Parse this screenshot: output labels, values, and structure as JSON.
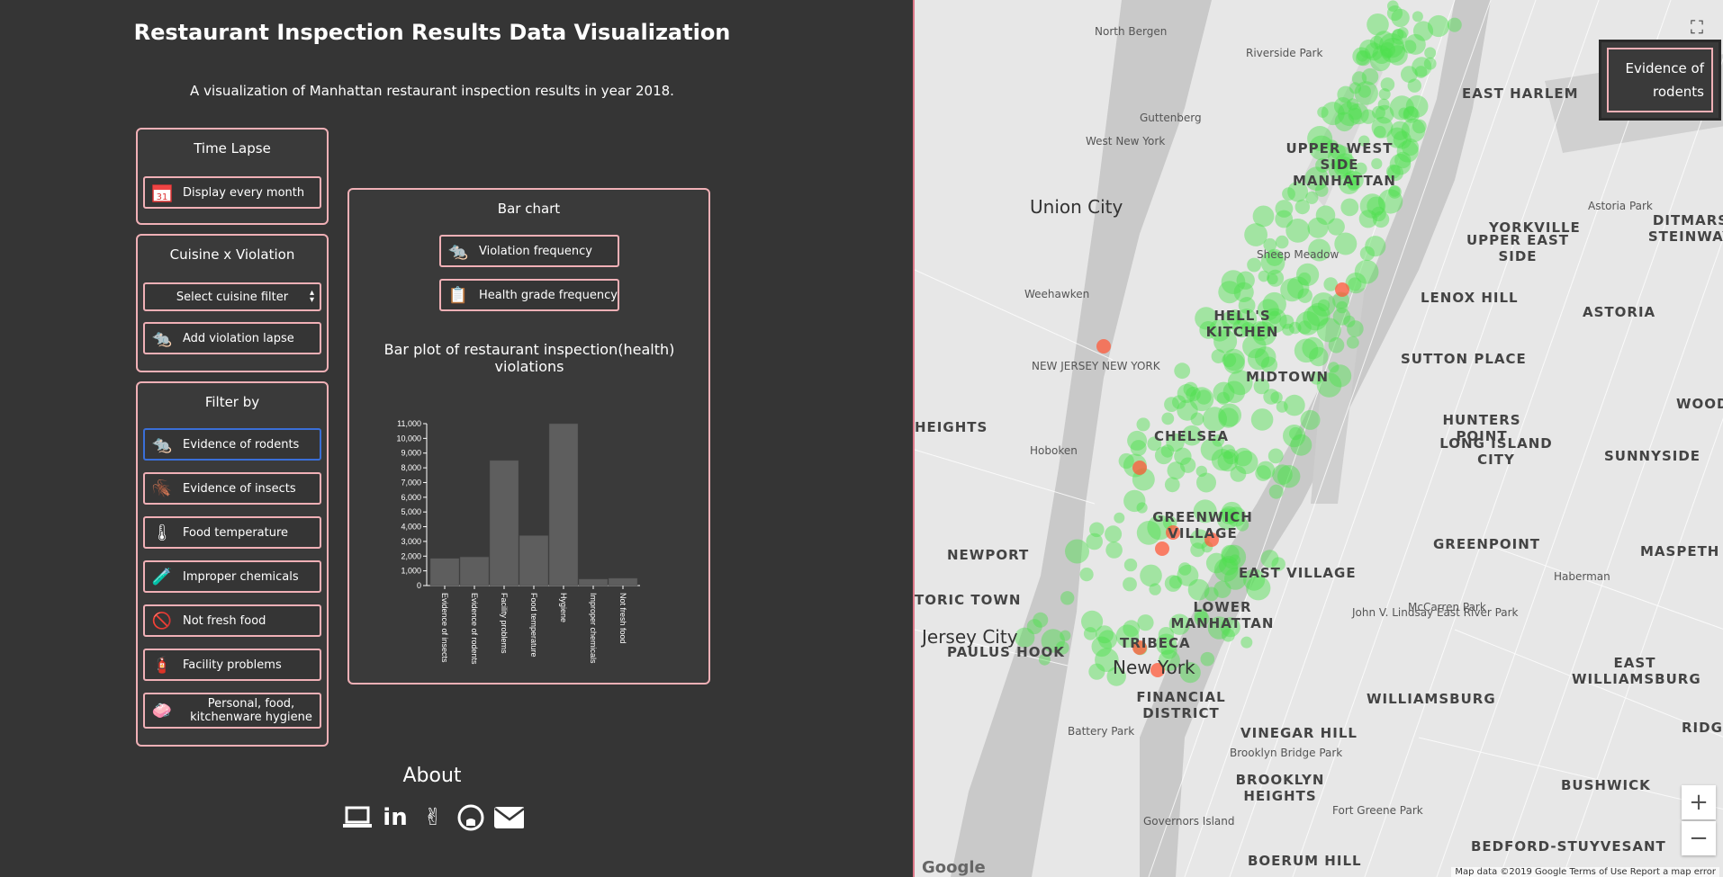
{
  "header": {
    "title": "Restaurant Inspection Results Data Visualization",
    "subtitle": "A visualization of Manhattan restaurant inspection results in year 2018."
  },
  "time_lapse": {
    "title": "Time Lapse",
    "button": {
      "label": "Display every month",
      "icon": "calendar-icon"
    }
  },
  "cuisine": {
    "title": "Cuisine x Violation",
    "select_value": "Select cuisine filter",
    "button": {
      "label": "Add violation lapse",
      "icon": "rat-icon"
    }
  },
  "filter": {
    "title": "Filter by",
    "items": [
      {
        "label": "Evidence of rodents",
        "icon": "rat-icon",
        "glyph": "🐀",
        "active": true
      },
      {
        "label": "Evidence of insects",
        "icon": "insect-icon",
        "glyph": "🪳",
        "active": false
      },
      {
        "label": "Food temperature",
        "icon": "thermometer-icon",
        "glyph": "🌡",
        "active": false
      },
      {
        "label": "Improper chemicals",
        "icon": "chemical-bottle-icon",
        "glyph": "🧪",
        "active": false
      },
      {
        "label": "Not fresh food",
        "icon": "no-food-icon",
        "glyph": "🚫",
        "active": false
      },
      {
        "label": "Facility problems",
        "icon": "facility-icon",
        "glyph": "🧯",
        "active": false
      },
      {
        "label": "Personal, food, kitchenware hygiene",
        "icon": "handwash-icon",
        "glyph": "🧼",
        "active": false
      }
    ]
  },
  "bar_panel": {
    "title": "Bar chart",
    "buttons": [
      {
        "label": "Violation frequency",
        "icon": "rat-icon",
        "glyph": "🐀"
      },
      {
        "label": "Health grade frequency",
        "icon": "grade-report-icon",
        "glyph": "📋"
      }
    ]
  },
  "chart_data": {
    "type": "bar",
    "title": "Bar plot of restaurant inspection(health) violations",
    "categories": [
      "Evidence of insects",
      "Evidence of rodents",
      "Facility problems",
      "Food temperature",
      "Hygiene",
      "Improper chemicals",
      "Not fresh food"
    ],
    "values": [
      1850,
      1950,
      8500,
      3400,
      11000,
      450,
      500
    ],
    "ylim": [
      0,
      11000
    ],
    "yticks": [
      "0",
      "1,000",
      "2,000",
      "3,000",
      "4,000",
      "5,000",
      "6,000",
      "7,000",
      "8,000",
      "9,000",
      "10,000",
      "11,000"
    ],
    "color": "#5e5e5e",
    "xlabel": "",
    "ylabel": ""
  },
  "about": {
    "title": "About",
    "icons": [
      {
        "name": "laptop-icon",
        "glyph": "💻"
      },
      {
        "name": "linkedin-icon",
        "glyph": "in"
      },
      {
        "name": "angellist-icon",
        "glyph": "✌"
      },
      {
        "name": "github-icon",
        "glyph": "◉"
      },
      {
        "name": "email-icon",
        "glyph": "✉"
      }
    ]
  },
  "map": {
    "legend": "Evidence of rodents",
    "zoom_in": "+",
    "zoom_out": "−",
    "fullscreen": "⛶",
    "google": "Google",
    "attribution": "Map data ©2019 Google   Terms of Use   Report a map error",
    "labels": [
      {
        "text": "North Bergen"
      },
      {
        "text": "Riverside Park"
      },
      {
        "text": "EAST HARLEM"
      },
      {
        "text": "Guttenberg"
      },
      {
        "text": "West New York"
      },
      {
        "text": "UPPER WEST SIDE"
      },
      {
        "text": "MANHATTAN"
      },
      {
        "text": "Union City"
      },
      {
        "text": "YORKVILLE"
      },
      {
        "text": "DITMARS STEINWAY"
      },
      {
        "text": "Sheep Meadow"
      },
      {
        "text": "UPPER EAST SIDE"
      },
      {
        "text": "Astoria Park"
      },
      {
        "text": "Weehawken"
      },
      {
        "text": "LENOX HILL"
      },
      {
        "text": "ASTORIA"
      },
      {
        "text": "HELL'S KITCHEN"
      },
      {
        "text": "SUTTON PLACE"
      },
      {
        "text": "MIDTOWN"
      },
      {
        "text": "HEIGHTS"
      },
      {
        "text": "HUNTERS POINT"
      },
      {
        "text": "WOODSIDE"
      },
      {
        "text": "Hoboken"
      },
      {
        "text": "CHELSEA"
      },
      {
        "text": "LONG ISLAND CITY"
      },
      {
        "text": "SUNNYSIDE"
      },
      {
        "text": "GREENWICH VILLAGE"
      },
      {
        "text": "GREENPOINT"
      },
      {
        "text": "MASPETH"
      },
      {
        "text": "NEWPORT"
      },
      {
        "text": "EAST VILLAGE"
      },
      {
        "text": "Haberman"
      },
      {
        "text": "TORIC TOWN"
      },
      {
        "text": "LOWER MANHATTAN"
      },
      {
        "text": "John V. Lindsay East River Park"
      },
      {
        "text": "McCarren Park"
      },
      {
        "text": "Jersey City"
      },
      {
        "text": "PAULUS HOOK"
      },
      {
        "text": "TRIBECA"
      },
      {
        "text": "EAST WILLIAMSBURG"
      },
      {
        "text": "New York"
      },
      {
        "text": "FINANCIAL DISTRICT"
      },
      {
        "text": "WILLIAMSBURG"
      },
      {
        "text": "RIDGEWO"
      },
      {
        "text": "Battery Park"
      },
      {
        "text": "VINEGAR HILL"
      },
      {
        "text": "Brooklyn Bridge Park"
      },
      {
        "text": "BROOKLYN HEIGHTS"
      },
      {
        "text": "BUSHWICK"
      },
      {
        "text": "Governors Island"
      },
      {
        "text": "Fort Greene Park"
      },
      {
        "text": "BEDFORD-STUYVESANT"
      },
      {
        "text": "BOERUM HILL"
      },
      {
        "text": "NEW JERSEY NEW YORK"
      }
    ]
  }
}
